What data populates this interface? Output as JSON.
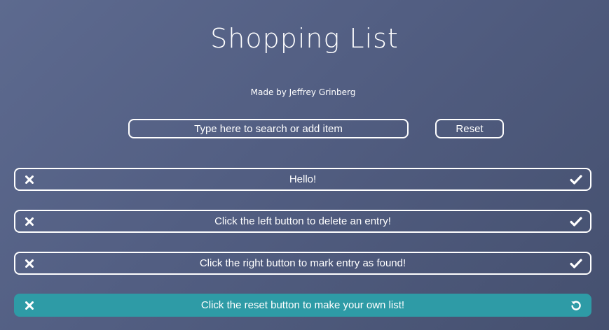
{
  "header": {
    "title": "Shopping List",
    "byline": "Made by Jeffrey Grinberg"
  },
  "controls": {
    "search_placeholder": "Type here to search or add item",
    "reset_label": "Reset"
  },
  "items": [
    {
      "text": "Hello!",
      "status": "pending",
      "left_icon": "close-icon",
      "right_icon": "check-icon"
    },
    {
      "text": "Click the left button to delete an entry!",
      "status": "pending",
      "left_icon": "close-icon",
      "right_icon": "check-icon"
    },
    {
      "text": "Click the right button to mark entry as found!",
      "status": "pending",
      "left_icon": "close-icon",
      "right_icon": "check-icon"
    },
    {
      "text": "Click the reset button to make your own list!",
      "status": "found",
      "left_icon": "close-icon",
      "right_icon": "undo-icon"
    }
  ],
  "colors": {
    "background_start": "#5d6a8f",
    "background_end": "#45506f",
    "found_item": "#2e9ba6",
    "foreground": "#ffffff"
  }
}
